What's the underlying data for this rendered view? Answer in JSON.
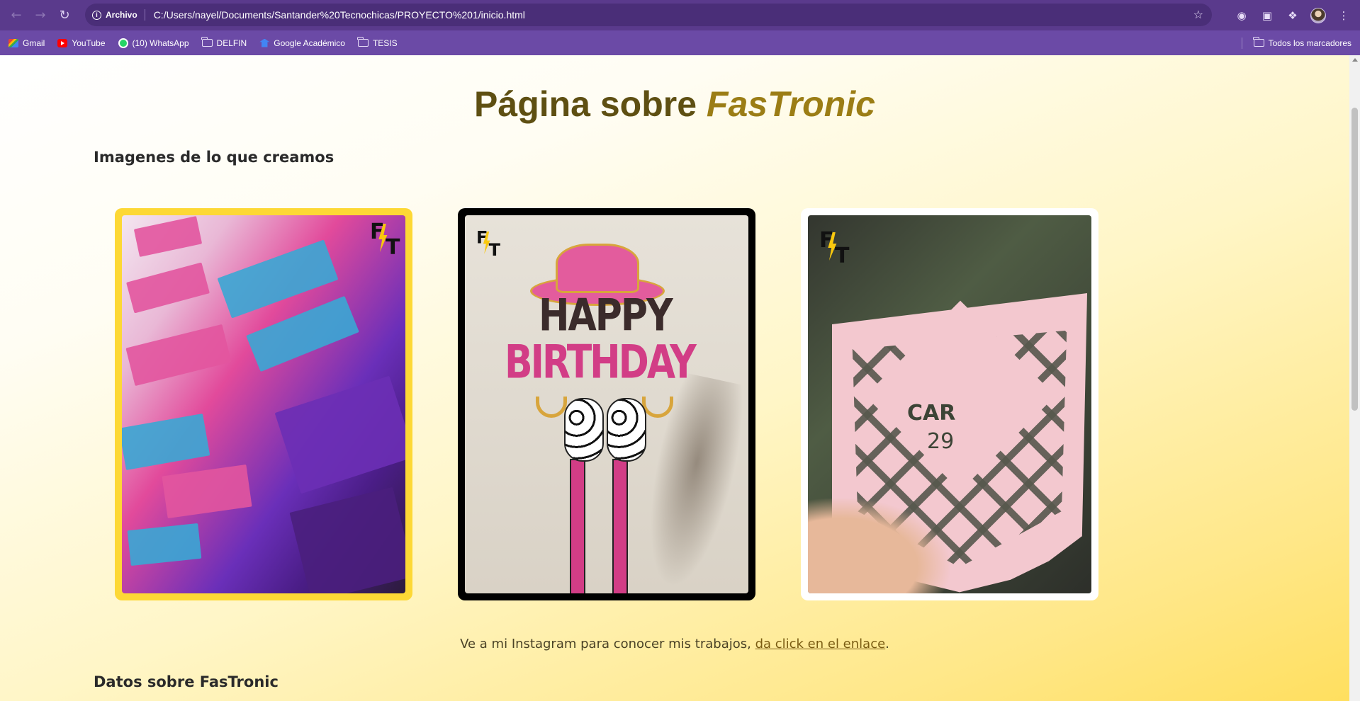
{
  "browser": {
    "omnibox": {
      "chip": "Archivo",
      "url": "C:/Users/nayel/Documents/Santander%20Tecnochicas/PROYECTO%201/inicio.html"
    },
    "bookmarks": [
      "Gmail",
      "YouTube",
      "(10) WhatsApp",
      "DELFIN",
      "Google Académico",
      "TESIS"
    ],
    "all_bookmarks": "Todos los marcadores"
  },
  "page": {
    "title_plain": "Página sobre ",
    "title_brand": "FasTronic",
    "images_heading": "Imagenes de lo que creamos",
    "photo2": {
      "happy": "HAPPY",
      "birthday": "BIRTHDAY"
    },
    "photo3": {
      "car": "CAR",
      "num": "29"
    },
    "logo": {
      "f": "F",
      "t": "T"
    },
    "instagram_text": "Ve a mi Instagram para conocer mis trabajos, ",
    "instagram_link": "da click en el enlace",
    "instagram_end": ".",
    "datos_heading": "Datos sobre FasTronic"
  },
  "colors": {
    "chrome": "#5a3a8c",
    "bookmark_bar": "#6b4aa6",
    "card_1_frame": "#fdd835",
    "card_2_frame": "#000000",
    "card_3_frame": "#ffffff",
    "title": "#5e4f12"
  }
}
